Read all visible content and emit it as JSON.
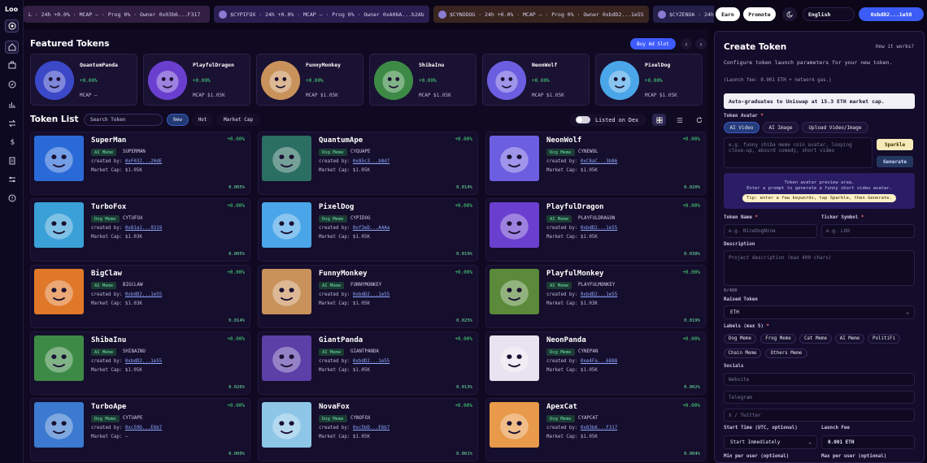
{
  "app": {
    "name": "Loo"
  },
  "ticker": [
    {
      "text": "L · 24h +0.0% · MCAP — · Prog 0% · Owner 0x03b6...F317",
      "bg": "#341f44"
    },
    {
      "text": "$CYPIFOX · 24h +0.0% · MCAP — · Prog 0% · Owner 0xA06A...b2Ab",
      "bg": "#2a1f52"
    },
    {
      "text": "$CYNODOG · 24h +0.0% · MCAP — · Prog 0% · Owner 0xbdD2...1e55",
      "bg": "#3a2520"
    },
    {
      "text": "$CYZENOA · 24h +0",
      "bg": "#23204a"
    }
  ],
  "topbar": {
    "earn": "Earn",
    "promote": "Promote",
    "language": "English",
    "wallet": "0xbdD2...1e58",
    "theme_icon": "moon-icon"
  },
  "featured": {
    "title": "Featured Tokens",
    "ad_slot": "Buy Ad Slot",
    "items": [
      {
        "name": "QuantumPanda",
        "change": "+0.00%",
        "mcap": "MCAP —",
        "color": "#3b48c8"
      },
      {
        "name": "PlayfulDragon",
        "change": "+0.00%",
        "mcap": "MCAP $1.05K",
        "color": "#6a3fd0"
      },
      {
        "name": "FunnyMonkey",
        "change": "+0.00%",
        "mcap": "MCAP $1.05K",
        "color": "#c9925b"
      },
      {
        "name": "ShibaInu",
        "change": "+0.00%",
        "mcap": "MCAP $1.05K",
        "color": "#3d8a46"
      },
      {
        "name": "NeonWolf",
        "change": "+0.00%",
        "mcap": "MCAP $1.05K",
        "color": "#6c5ee0"
      },
      {
        "name": "PixelDog",
        "change": "+0.00%",
        "mcap": "MCAP $1.05K",
        "color": "#4aa6e8"
      }
    ]
  },
  "list": {
    "title": "Token List",
    "search_placeholder": "Search Token",
    "filters": [
      "New",
      "Hot",
      "Market Cap"
    ],
    "listed_on_dex": "Listed on Dex",
    "tokens": [
      {
        "name": "SuperMan",
        "label": "AI Meme",
        "symbol": "SUPERMAN",
        "creator": "0xF032...20dE",
        "mcap": "Market Cap: $1.05K",
        "change": "+0.00%",
        "progress": "0.005%",
        "color": "#2a6ad8"
      },
      {
        "name": "QuantumApe",
        "label": "Dog Meme",
        "symbol": "CYQUAPE",
        "creator": "0x85c3...b8d7",
        "mcap": "Market Cap: $1.05K",
        "change": "+0.00%",
        "progress": "0.014%",
        "color": "#2b6e62"
      },
      {
        "name": "NeonWolf",
        "label": "Dog Meme",
        "symbol": "CYNEWOL",
        "creator": "0xC8aC...3b86",
        "mcap": "Market Cap: $1.05K",
        "change": "+0.00%",
        "progress": "0.020%",
        "color": "#6c5ee0"
      },
      {
        "name": "TurboFox",
        "label": "Dog Meme",
        "symbol": "CYTUFOX",
        "creator": "0x81a1...9319",
        "mcap": "Market Cap: $1.03K",
        "change": "+0.00%",
        "progress": "0.005%",
        "color": "#3aa0d8"
      },
      {
        "name": "PixelDog",
        "label": "Dog Meme",
        "symbol": "CYPIDOG",
        "creator": "0xf3eD...A4Aa",
        "mcap": "Market Cap: $1.05K",
        "change": "+0.00%",
        "progress": "0.019%",
        "color": "#4aa6e8"
      },
      {
        "name": "PlayfulDragon",
        "label": "AI Meme",
        "symbol": "PLAYFULDRAGON",
        "creator": "0xbdD2...1e55",
        "mcap": "Market Cap: $1.05K",
        "change": "+0.00%",
        "progress": "0.038%",
        "color": "#6a3fd0"
      },
      {
        "name": "BigClaw",
        "label": "AI Meme",
        "symbol": "BIGCLAW",
        "creator": "0xbdD2...1e55",
        "mcap": "Market Cap: $1.03K",
        "change": "+0.00%",
        "progress": "0.014%",
        "color": "#e0782a"
      },
      {
        "name": "FunnyMonkey",
        "label": "AI Meme",
        "symbol": "FUNNYMONKEY",
        "creator": "0xbdD2...1e55",
        "mcap": "Market Cap: $1.05K",
        "change": "+0.00%",
        "progress": "0.025%",
        "color": "#c9925b"
      },
      {
        "name": "PlayfulMonkey",
        "label": "AI Meme",
        "symbol": "PLAYFULMONKEY",
        "creator": "0xbdD2...1e55",
        "mcap": "Market Cap: $1.03K",
        "change": "+0.00%",
        "progress": "0.019%",
        "color": "#5a8a3a"
      },
      {
        "name": "ShibaInu",
        "label": "AI Meme",
        "symbol": "SHIBAINU",
        "creator": "0xbdD2...1e55",
        "mcap": "Market Cap: $1.05K",
        "change": "+0.00%",
        "progress": "0.026%",
        "color": "#3d8a46"
      },
      {
        "name": "GiantPanda",
        "label": "AI Meme",
        "symbol": "GIANTPANDA",
        "creator": "0xbdD2...1e55",
        "mcap": "Market Cap: $1.05K",
        "change": "+0.00%",
        "progress": "0.013%",
        "color": "#5d3fa8"
      },
      {
        "name": "NeonPanda",
        "label": "Dog Meme",
        "symbol": "CYNEPAN",
        "creator": "0xe4Fa...6888",
        "mcap": "Market Cap: $1.05K",
        "change": "+0.00%",
        "progress": "0.002%",
        "color": "#e8e3f0"
      },
      {
        "name": "TurboApe",
        "label": "Dog Meme",
        "symbol": "CYTUAPE",
        "creator": "0xc59D...E6b7",
        "mcap": "Market Cap: —",
        "change": "+0.00%",
        "progress": "0.000%",
        "color": "#3b7ad0"
      },
      {
        "name": "NovaFox",
        "label": "Dog Meme",
        "symbol": "CYNOFOX",
        "creator": "0xc5bD...E6b7",
        "mcap": "Market Cap: $1.05K",
        "change": "+0.00%",
        "progress": "0.001%",
        "color": "#8ec6e8"
      },
      {
        "name": "ApexCat",
        "label": "Dog Meme",
        "symbol": "CYAPCAT",
        "creator": "0x83b6...F317",
        "mcap": "Market Cap: $1.05K",
        "change": "+0.00%",
        "progress": "0.004%",
        "color": "#e89a4a"
      }
    ]
  },
  "create": {
    "title": "Create Token",
    "how": "How it works?",
    "desc": "Configure token launch parameters for your new token.",
    "fee_note": "(Launch fee: 0.001 ETH + network gas.)",
    "info": "Auto-graduates to Uniswap at 15.3 ETH market cap.",
    "avatar_label": "Token Avatar",
    "avatar_tabs": [
      "AI Video",
      "AI Image",
      "Upload Video/Image"
    ],
    "prompt_placeholder": "e.g. funny shiba meme coin avatar, looping close-up, absurd comedy, short video",
    "sparkle": "Sparkle",
    "generate": "Generate",
    "preview_text": "Token avatar preview area.",
    "preview_sub": "Enter a prompt to generate a funny short video avatar.",
    "tip": "Tip: enter a few keywords, tap Sparkle, then Generate.",
    "name_label": "Token Name",
    "name_placeholder": "e.g. NiceDogNine",
    "symbol_label": "Ticker Symbol",
    "symbol_placeholder": "e.g. LOO",
    "desc_label": "Description",
    "desc_placeholder": "Project description (max 400 chars)",
    "desc_count": "0/400",
    "raised_label": "Raised Token",
    "raised_value": "ETH",
    "labels_label": "Labels (max 5)",
    "labels": [
      "Dog Meme",
      "Frog Meme",
      "Cat Meme",
      "AI Meme",
      "PolitiFi",
      "Chain Meme",
      "Others Meme"
    ],
    "socials_label": "Socials",
    "website_placeholder": "Website",
    "telegram_placeholder": "Telegram",
    "x_placeholder": "X / Twitter",
    "start_label": "Start Time (UTC, optional)",
    "start_value": "Start Immediately",
    "launch_fee_label": "Launch Fee",
    "launch_fee_value": "0.001 ETH",
    "min_label": "Min per user (optional)",
    "max_label": "Max per user (optional)"
  }
}
